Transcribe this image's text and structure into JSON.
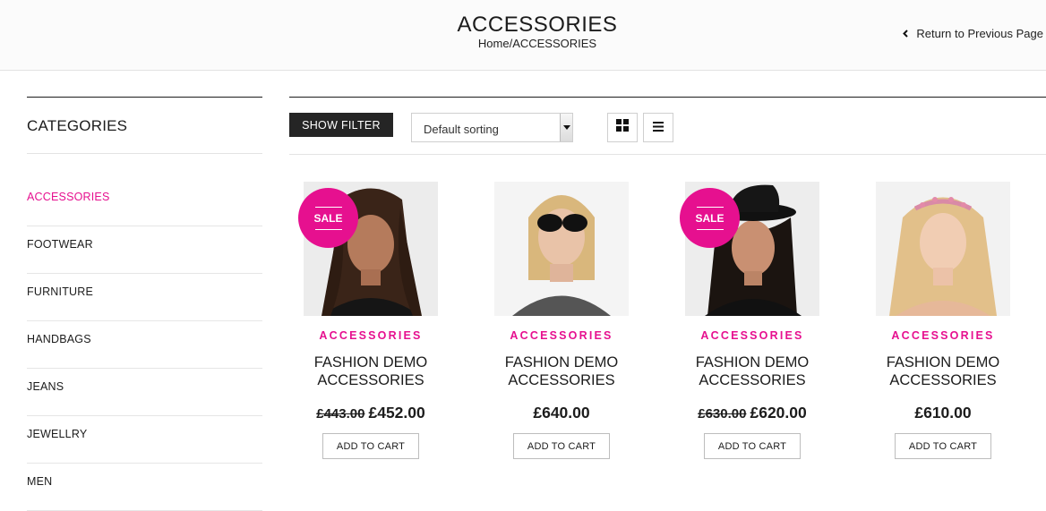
{
  "header": {
    "title": "ACCESSORIES",
    "breadcrumb_home": "Home",
    "breadcrumb_sep": "/",
    "breadcrumb_current": "ACCESSORIES",
    "return_label": "Return to Previous Page"
  },
  "sidebar": {
    "title": "CATEGORIES",
    "items": [
      {
        "label": "ACCESSORIES",
        "active": true
      },
      {
        "label": "FOOTWEAR"
      },
      {
        "label": "FURNITURE"
      },
      {
        "label": "HANDBAGS"
      },
      {
        "label": "JEANS"
      },
      {
        "label": "JEWELLRY"
      },
      {
        "label": "MEN"
      }
    ]
  },
  "toolbar": {
    "show_filter_label": "SHOW FILTER",
    "sort_value": "Default sorting"
  },
  "products": [
    {
      "category": "ACCESSORIES",
      "name_line1": "FASHION DEMO",
      "name_line2": "ACCESSORIES",
      "old_price": "£443.00",
      "price": "£452.00",
      "sale": "SALE",
      "cart_label": "ADD TO CART"
    },
    {
      "category": "ACCESSORIES",
      "name_line1": "FASHION DEMO",
      "name_line2": "ACCESSORIES",
      "price": "£640.00",
      "cart_label": "ADD TO CART"
    },
    {
      "category": "ACCESSORIES",
      "name_line1": "FASHION DEMO",
      "name_line2": "ACCESSORIES",
      "old_price": "£630.00",
      "price": "£620.00",
      "sale": "SALE",
      "cart_label": "ADD TO CART"
    },
    {
      "category": "ACCESSORIES",
      "name_line1": "FASHION DEMO",
      "name_line2": "ACCESSORIES",
      "price": "£610.00",
      "cart_label": "ADD TO CART"
    }
  ],
  "colors": {
    "accent": "#e6108f",
    "dark": "#252525"
  },
  "icons": {
    "return": "chevron-left-icon",
    "grid_view": "grid-icon",
    "list_view": "list-icon",
    "sort": "caret-down-icon"
  }
}
